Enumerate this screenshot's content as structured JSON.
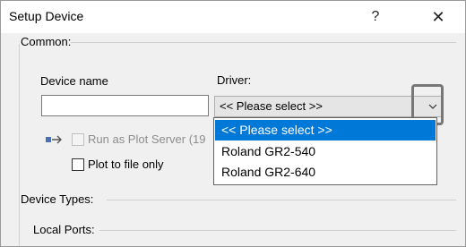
{
  "window": {
    "title": "Setup Device",
    "help_glyph": "?",
    "close_glyph": "✕"
  },
  "common": {
    "group_label": "Common:",
    "device_name_label": "Device name",
    "device_name_value": "",
    "driver_label": "Driver:",
    "driver_selected": "<< Please select >>",
    "driver_options": [
      "<< Please select >>",
      "Roland GR2-540",
      "Roland GR2-640"
    ],
    "run_as_plot_server_label": "Run as Plot Server (19",
    "run_as_plot_server_checked": false,
    "plot_to_file_label": "Plot to file only",
    "plot_to_file_checked": false
  },
  "device_types_label": "Device Types:",
  "local_ports_label": "Local Ports:",
  "colors": {
    "selection": "#0078d7",
    "dialog_bg": "#f0f0f0"
  },
  "icons": {
    "server": "server-arrow-icon",
    "dropdown": "chevron-down-icon"
  }
}
